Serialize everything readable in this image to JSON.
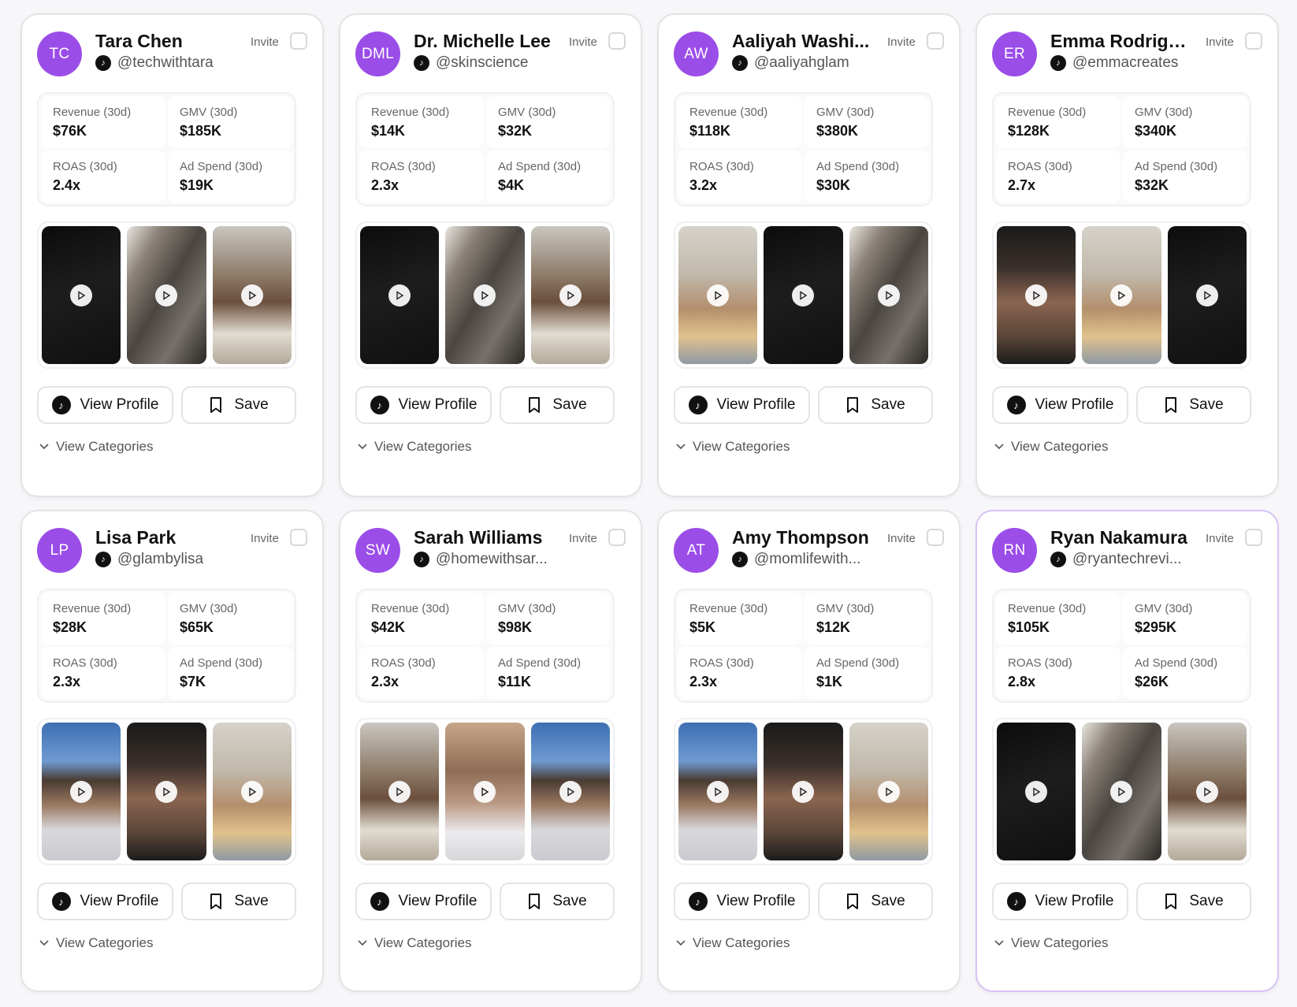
{
  "labels": {
    "invite": "Invite",
    "view_profile": "View Profile",
    "save": "Save",
    "view_categories": "View Categories",
    "revenue": "Revenue (30d)",
    "gmv": "GMV (30d)",
    "roas": "ROAS (30d)",
    "ad_spend": "Ad Spend (30d)"
  },
  "creators": [
    {
      "initials": "TC",
      "name": "Tara Chen",
      "handle": "@techwithtara",
      "revenue": "$76K",
      "gmv": "$185K",
      "roas": "2.4x",
      "ad_spend": "$19K"
    },
    {
      "initials": "DML",
      "name": "Dr. Michelle Lee",
      "handle": "@skinscience",
      "revenue": "$14K",
      "gmv": "$32K",
      "roas": "2.3x",
      "ad_spend": "$4K"
    },
    {
      "initials": "AW",
      "name": "Aaliyah Washi...",
      "handle": "@aaliyahglam",
      "revenue": "$118K",
      "gmv": "$380K",
      "roas": "3.2x",
      "ad_spend": "$30K"
    },
    {
      "initials": "ER",
      "name": "Emma Rodriguez",
      "handle": "@emmacreates",
      "revenue": "$128K",
      "gmv": "$340K",
      "roas": "2.7x",
      "ad_spend": "$32K"
    },
    {
      "initials": "LP",
      "name": "Lisa Park",
      "handle": "@glambylisa",
      "revenue": "$28K",
      "gmv": "$65K",
      "roas": "2.3x",
      "ad_spend": "$7K"
    },
    {
      "initials": "SW",
      "name": "Sarah Williams",
      "handle": "@homewithsar...",
      "revenue": "$42K",
      "gmv": "$98K",
      "roas": "2.3x",
      "ad_spend": "$11K"
    },
    {
      "initials": "AT",
      "name": "Amy Thompson",
      "handle": "@momlifewith...",
      "revenue": "$5K",
      "gmv": "$12K",
      "roas": "2.3x",
      "ad_spend": "$1K"
    },
    {
      "initials": "RN",
      "name": "Ryan Nakamura",
      "handle": "@ryantechrevi...",
      "revenue": "$105K",
      "gmv": "$295K",
      "roas": "2.8x",
      "ad_spend": "$26K"
    }
  ],
  "colors": {
    "avatar": "#9b4de8",
    "active_border": "#d7c2f5"
  }
}
